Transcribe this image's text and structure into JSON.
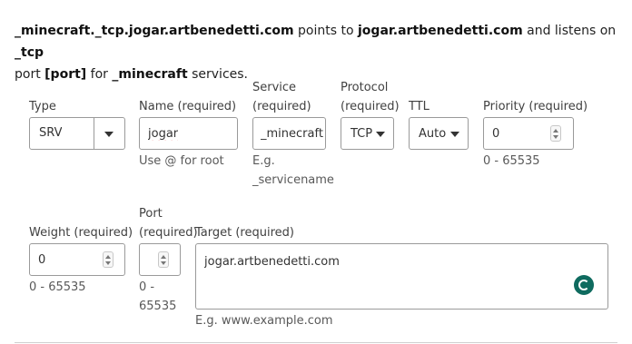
{
  "summary": {
    "record_name": "_minecraft._tcp.jogar.artbenedetti.com",
    "text_points_to": " points to ",
    "target": "jogar.artbenedetti.com",
    "text_listens_on": " and listens on ",
    "protocol": "_tcp",
    "text_port": " port ",
    "port": "[port]",
    "text_for": " for ",
    "service": "_minecraft",
    "text_services": " services."
  },
  "fields": {
    "type": {
      "label": "Type",
      "value": "SRV"
    },
    "name": {
      "label": "Name (required)",
      "value": "jogar",
      "hint": "Use @ for root"
    },
    "service": {
      "label_line1": "Service",
      "label_line2": "(required)",
      "value": "_minecraft",
      "hint_line1": "E.g.",
      "hint_line2": "_servicename"
    },
    "protocol": {
      "label_line1": "Protocol",
      "label_line2": "(required)",
      "value": "TCP"
    },
    "ttl": {
      "label": "TTL",
      "value": "Auto"
    },
    "priority": {
      "label": "Priority (required)",
      "value": "0",
      "hint": "0 - 65535"
    },
    "weight": {
      "label": "Weight (required)",
      "value": "0",
      "hint": "0 - 65535"
    },
    "port": {
      "label_line1": "Port",
      "label_line2": "(required)",
      "value": "",
      "hint_line1": "0 -",
      "hint_line2": "65535"
    },
    "target": {
      "label": "Target (required)",
      "value": "jogar.artbenedetti.com",
      "hint": "E.g. www.example.com"
    }
  },
  "colors": {
    "accent": "#0f6b5f",
    "border": "#9a9a9a",
    "text": "#313131"
  }
}
